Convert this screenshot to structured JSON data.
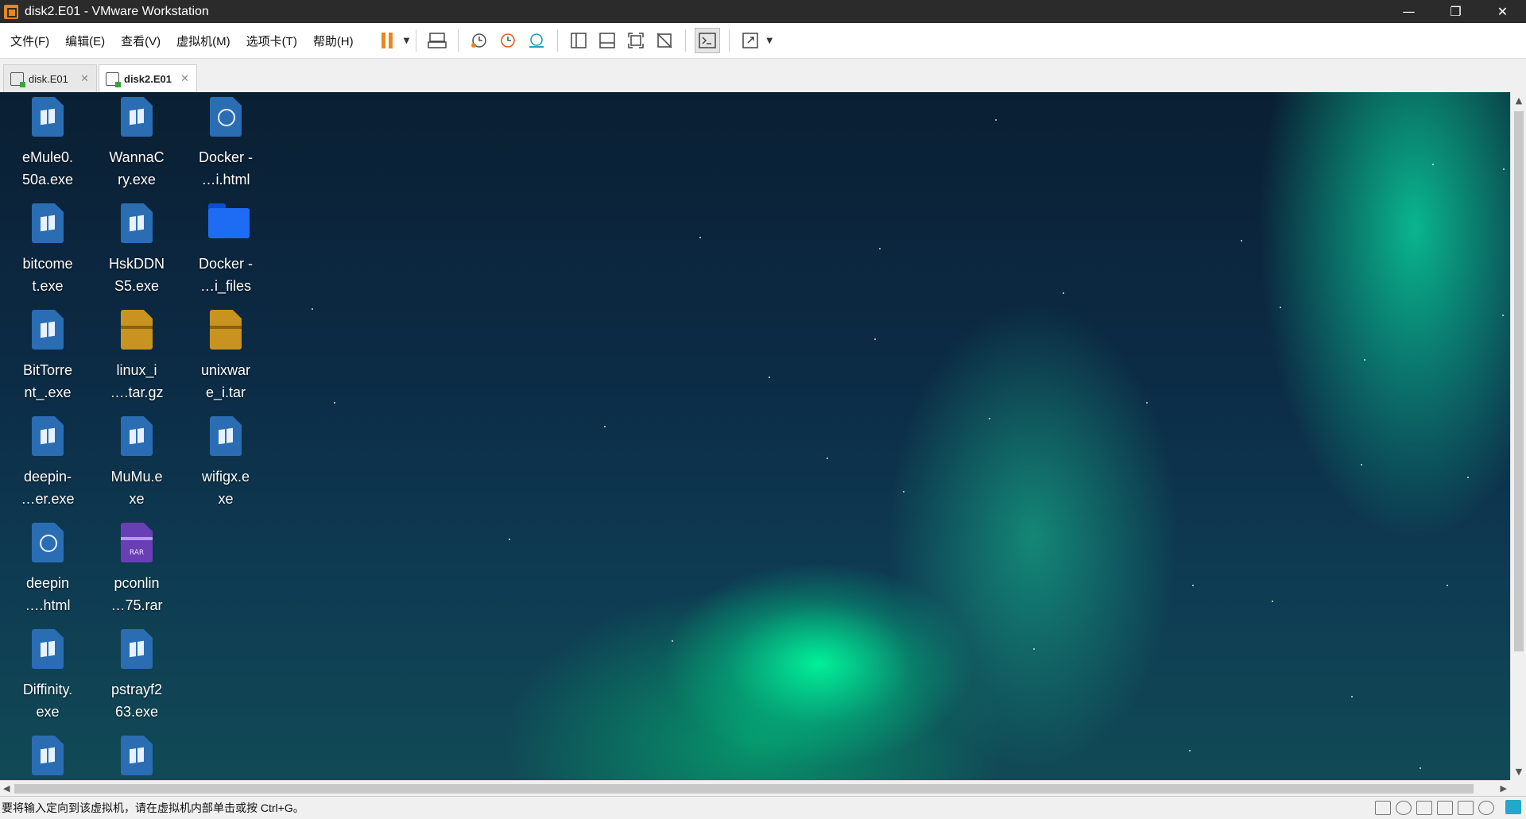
{
  "window": {
    "title": "disk2.E01 - VMware Workstation",
    "minimize": "—",
    "restore": "❐",
    "close": "✕"
  },
  "menu": [
    "文件(F)",
    "编辑(E)",
    "查看(V)",
    "虚拟机(M)",
    "选项卡(T)",
    "帮助(H)"
  ],
  "tabs": [
    {
      "label": "disk.E01",
      "close": "✕"
    },
    {
      "label": "disk2.E01",
      "close": "✕"
    }
  ],
  "desktop_icons": [
    {
      "label": "eMule0.\n50a.exe",
      "type": "exe"
    },
    {
      "label": "WannaC\nry.exe",
      "type": "exe"
    },
    {
      "label": "Docker -\n…i.html",
      "type": "html"
    },
    {
      "label": "bitcome\nt.exe",
      "type": "exe"
    },
    {
      "label": "HskDDN\nS5.exe",
      "type": "exe"
    },
    {
      "label": "Docker -\n…i_files",
      "type": "folder"
    },
    {
      "label": "BitTorre\nnt_.exe",
      "type": "exe"
    },
    {
      "label": "linux_i\n….tar.gz",
      "type": "archive"
    },
    {
      "label": "unixwar\ne_i.tar",
      "type": "archive"
    },
    {
      "label": "deepin-\n…er.exe",
      "type": "exe"
    },
    {
      "label": "MuMu.e\nxe",
      "type": "exe"
    },
    {
      "label": "wifigx.e\nxe",
      "type": "exe"
    },
    {
      "label": "deepin\n….html",
      "type": "html"
    },
    {
      "label": "pconlin\n…75.rar",
      "type": "rar"
    },
    {
      "label": "Diffinity.\nexe",
      "type": "exe"
    },
    {
      "label": "pstrayf2\n63.exe",
      "type": "exe"
    },
    {
      "label": "",
      "type": "exe"
    },
    {
      "label": "",
      "type": "exe"
    }
  ],
  "rar_badge": "RAR",
  "status": {
    "message": "要将输入定向到该虚拟机，请在虚拟机内部单击或按 Ctrl+G。"
  },
  "colors": {
    "titlebar": "#2b2b2b",
    "accent": "#e8871e",
    "exe": "#2a6db3",
    "folder": "#1e6cf3",
    "archive": "#c99320",
    "rar": "#6a3fb5"
  }
}
